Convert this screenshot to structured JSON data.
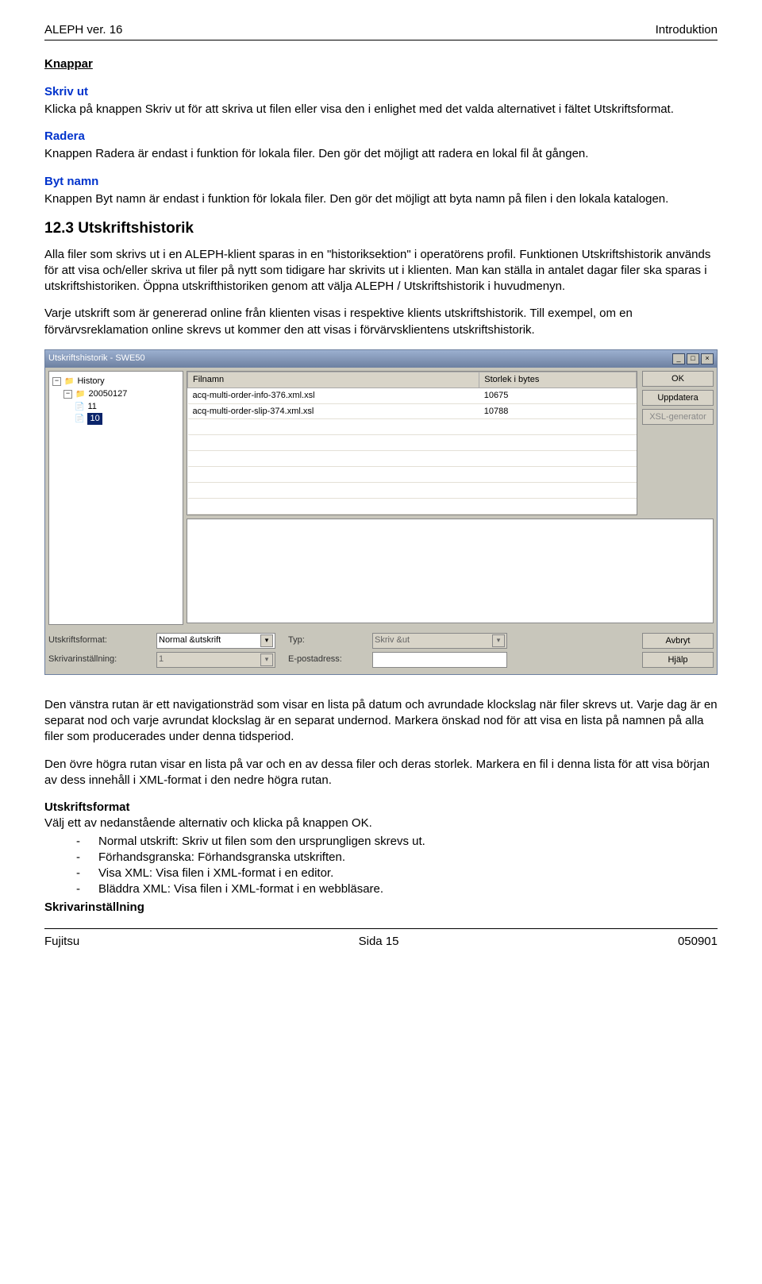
{
  "header": {
    "left": "ALEPH ver. 16",
    "right": "Introduktion"
  },
  "knappar": {
    "heading": "Knappar",
    "skrivut_label": "Skriv ut",
    "skrivut_text": "Klicka på knappen Skriv ut för att skriva ut filen eller visa den i enlighet med det valda alternativet i fältet Utskriftsformat.",
    "radera_label": "Radera",
    "radera_text": "Knappen Radera är endast i funktion för lokala filer. Den gör det möjligt att radera en lokal fil åt gången.",
    "bytnamn_label": "Byt namn",
    "bytnamn_text": "Knappen Byt namn är endast i funktion för lokala filer. Den gör det möjligt att byta namn på filen i den lokala katalogen."
  },
  "section": {
    "heading": "12.3 Utskriftshistorik",
    "p1": "Alla filer som skrivs ut i en ALEPH-klient sparas in en \"historiksektion\" i operatörens profil. Funktionen Utskriftshistorik används för att visa och/eller skriva ut filer på nytt som tidigare har skrivits ut i klienten. Man kan ställa in antalet dagar filer ska sparas i utskriftshistoriken. Öppna utskrifthistoriken genom att välja ALEPH / Utskriftshistorik i huvudmenyn.",
    "p2": "Varje utskrift som är genererad online från klienten visas i respektive klients utskriftshistorik. Till exempel, om en förvärvsreklamation online skrevs ut kommer den att visas i förvärvsklientens utskriftshistorik."
  },
  "screenshot": {
    "title": "Utskriftshistorik - SWE50",
    "tree_root": "History",
    "tree_date": "20050127",
    "tree_n1": "11",
    "tree_n2_sel": "10",
    "col_file": "Filnamn",
    "col_size": "Storlek i bytes",
    "rows": [
      {
        "f": "acq-multi-order-info-376.xml.xsl",
        "s": "10675"
      },
      {
        "f": "acq-multi-order-slip-374.xml.xsl",
        "s": "10788"
      }
    ],
    "btn_ok": "OK",
    "btn_upd": "Uppdatera",
    "btn_xsl": "XSL-generator",
    "lbl_format": "Utskriftsformat:",
    "val_format": "Normal &utskrift",
    "lbl_typ": "Typ:",
    "val_typ": "Skriv &ut",
    "lbl_skrivar": "Skrivarinställning:",
    "val_skrivar": "1",
    "lbl_epost": "E-postadress:",
    "btn_cancel": "Avbryt",
    "btn_help": "Hjälp"
  },
  "post": {
    "p1": "Den vänstra rutan är ett navigationsträd som visar en lista på datum och avrundade klockslag när filer skrevs ut. Varje dag är en separat nod och varje avrundat klockslag är en separat undernod. Markera önskad nod för att visa en lista på namnen på alla filer som producerades under denna tidsperiod.",
    "p2": "Den övre högra rutan visar en lista på var och en av dessa filer och deras storlek. Markera en fil i denna lista för att visa början av dess innehåll i XML-format i den nedre högra rutan.",
    "uf_head": "Utskriftsformat",
    "uf_intro": "Välj ett av nedanstående alternativ och klicka på knappen OK.",
    "opt1": "Normal utskrift: Skriv ut filen som den ursprungligen skrevs ut.",
    "opt2": "Förhandsgranska: Förhandsgranska utskriften.",
    "opt3": "Visa XML: Visa filen i XML-format i en editor.",
    "opt4": "Bläddra XML: Visa filen i XML-format i en webbläsare.",
    "si_head": "Skrivarinställning"
  },
  "footer": {
    "left": "Fujitsu",
    "center": "Sida 15",
    "right": "050901"
  }
}
